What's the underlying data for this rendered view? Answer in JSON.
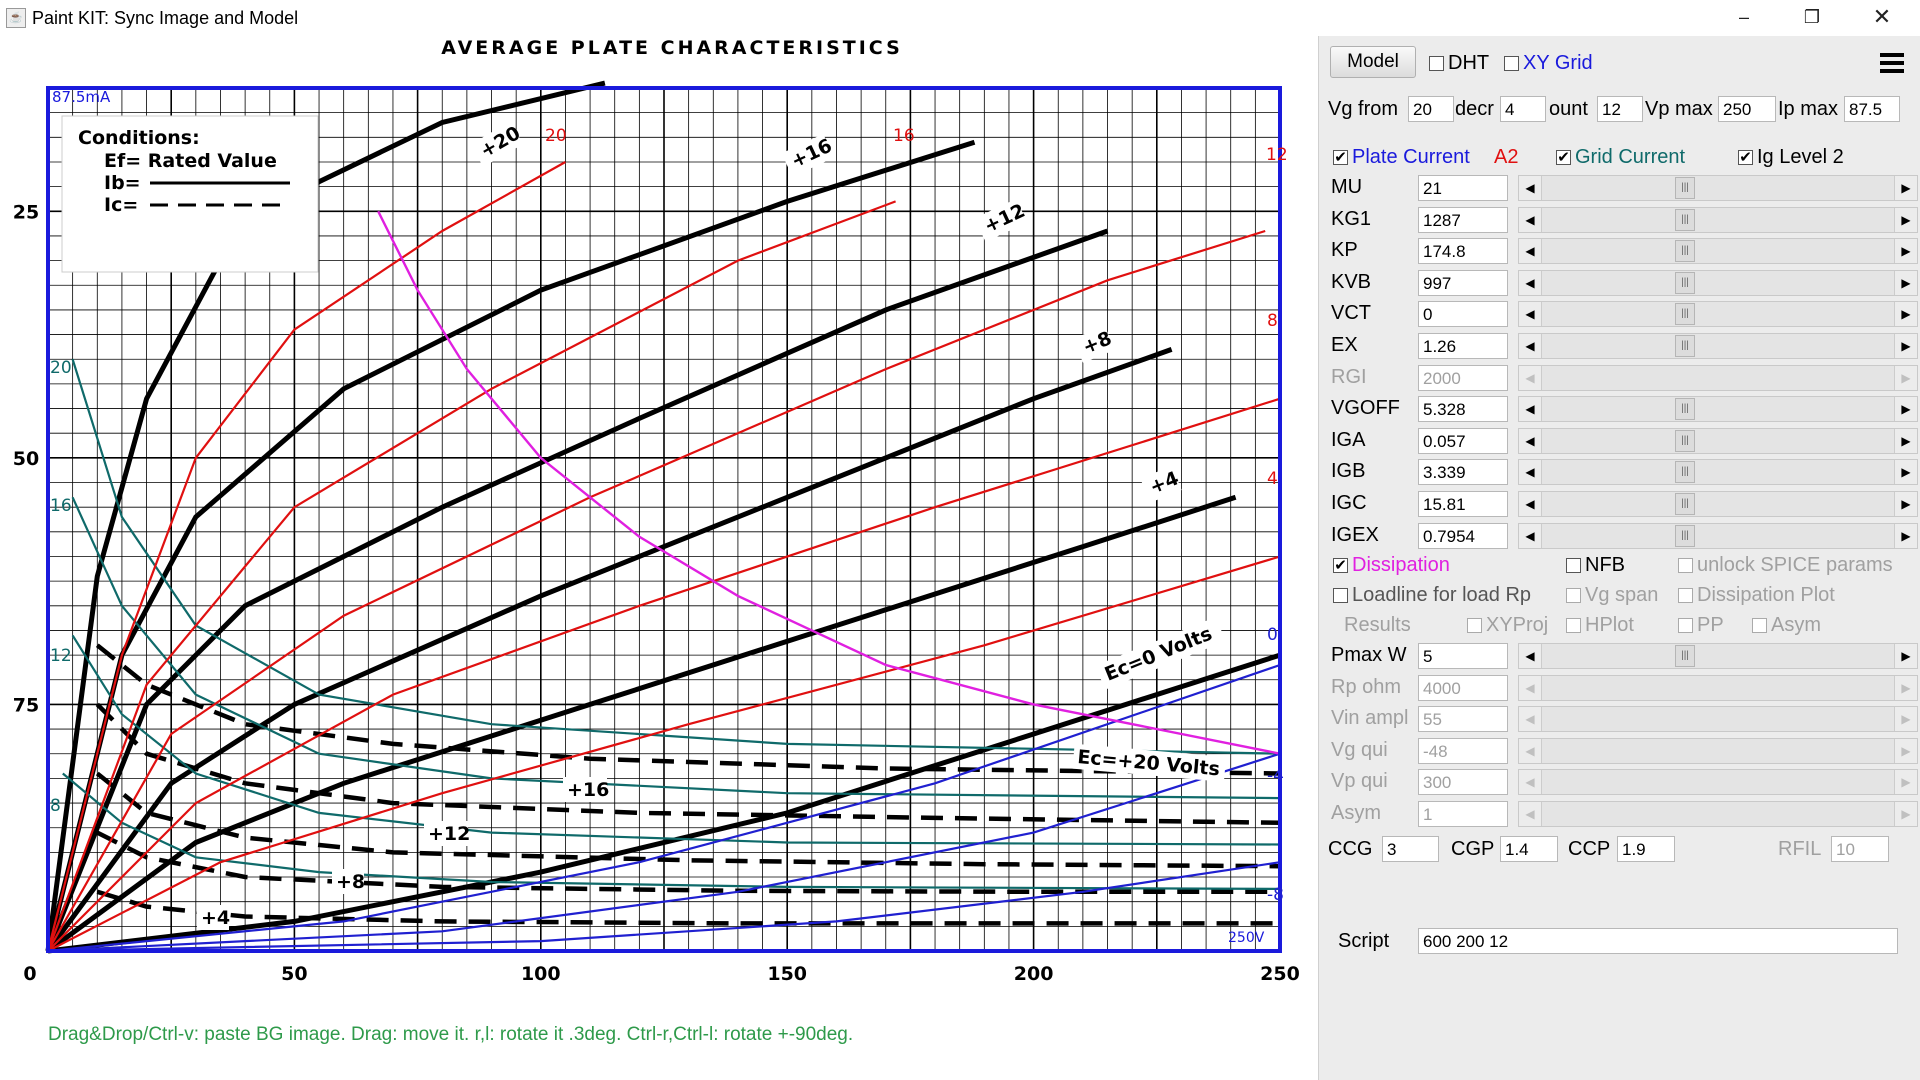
{
  "window": {
    "title": "Paint KIT: Sync Image and Model",
    "icon": "java-icon",
    "controls": [
      "minimize-icon",
      "restore-icon",
      "close-icon"
    ]
  },
  "plot": {
    "chart_title": "AVERAGE PLATE CHARACTERISTICS",
    "x_ticks": [
      "0",
      "50",
      "100",
      "150",
      "200",
      "250"
    ],
    "y_ticks": [
      "75",
      "50",
      "25"
    ],
    "corner_label": "87.5mA",
    "corner_label_br": "250V",
    "conditions": [
      "Conditions:",
      "Ef= Rated Value",
      "Ib=",
      "Ic="
    ],
    "plate_curve_labels": [
      "+20",
      "+16",
      "+12",
      "+8",
      "+4",
      "Ec=0 Volts"
    ],
    "grid_curve_labels": [
      "Ec=+20 Volts",
      "+16",
      "+12",
      "+8",
      "+4"
    ],
    "model_labels_top": [
      "20",
      "16",
      "12"
    ],
    "model_labels_right": [
      "8",
      "4",
      "0",
      "-4",
      "-8"
    ],
    "grid_model_labels_left": [
      "20",
      "16",
      "12",
      "8"
    ],
    "hint": "Drag&Drop/Ctrl-v: paste BG image. Drag: move it. r,l: rotate it .3deg. Ctrl-r,Ctrl-l: rotate +-90deg."
  },
  "chart_data": {
    "type": "line",
    "title": "AVERAGE PLATE CHARACTERISTICS",
    "xlim": [
      0,
      250
    ],
    "ylim": [
      0,
      87.5
    ],
    "x_ticks": [
      0,
      50,
      100,
      150,
      200,
      250
    ],
    "y_ticks": [
      25,
      50,
      75
    ],
    "grid": true,
    "plate_current_series": [
      {
        "name": "+20",
        "points": [
          [
            0,
            0
          ],
          [
            10,
            38
          ],
          [
            20,
            56
          ],
          [
            35,
            70
          ],
          [
            55,
            78
          ],
          [
            80,
            84
          ],
          [
            113,
            88
          ]
        ]
      },
      {
        "name": "+16",
        "points": [
          [
            0,
            0
          ],
          [
            15,
            30
          ],
          [
            30,
            44
          ],
          [
            60,
            57
          ],
          [
            100,
            67
          ],
          [
            150,
            76
          ],
          [
            188,
            82
          ]
        ]
      },
      {
        "name": "+12",
        "points": [
          [
            0,
            0
          ],
          [
            20,
            25
          ],
          [
            40,
            35
          ],
          [
            80,
            45
          ],
          [
            120,
            54
          ],
          [
            170,
            65
          ],
          [
            215,
            73
          ]
        ]
      },
      {
        "name": "+8",
        "points": [
          [
            0,
            0
          ],
          [
            25,
            17
          ],
          [
            50,
            25
          ],
          [
            100,
            36
          ],
          [
            150,
            46
          ],
          [
            200,
            56
          ],
          [
            228,
            61
          ]
        ]
      },
      {
        "name": "+4",
        "points": [
          [
            0,
            0
          ],
          [
            30,
            11
          ],
          [
            60,
            17
          ],
          [
            110,
            25
          ],
          [
            160,
            33
          ],
          [
            210,
            41
          ],
          [
            241,
            46
          ]
        ]
      },
      {
        "name": "Ec=0 Volts",
        "points": [
          [
            0,
            0
          ],
          [
            50,
            3
          ],
          [
            100,
            8
          ],
          [
            150,
            14
          ],
          [
            200,
            22
          ],
          [
            250,
            30
          ]
        ]
      }
    ],
    "grid_current_series": [
      {
        "name": "Ec=+20 Volts",
        "points": [
          [
            10,
            31
          ],
          [
            20,
            27
          ],
          [
            40,
            23
          ],
          [
            70,
            21
          ],
          [
            110,
            19.5
          ],
          [
            170,
            18.5
          ],
          [
            250,
            18
          ]
        ]
      },
      {
        "name": "+16",
        "points": [
          [
            10,
            25
          ],
          [
            20,
            20
          ],
          [
            40,
            17
          ],
          [
            70,
            15
          ],
          [
            120,
            14
          ],
          [
            180,
            13.5
          ],
          [
            250,
            13
          ]
        ]
      },
      {
        "name": "+12",
        "points": [
          [
            10,
            18
          ],
          [
            20,
            14
          ],
          [
            40,
            11.5
          ],
          [
            70,
            10
          ],
          [
            130,
            9.2
          ],
          [
            190,
            8.8
          ],
          [
            250,
            8.6
          ]
        ]
      },
      {
        "name": "+8",
        "points": [
          [
            10,
            12
          ],
          [
            20,
            9.5
          ],
          [
            40,
            7.5
          ],
          [
            80,
            6.5
          ],
          [
            140,
            6.1
          ],
          [
            200,
            6
          ],
          [
            250,
            6
          ]
        ]
      },
      {
        "name": "+4",
        "points": [
          [
            10,
            6
          ],
          [
            20,
            4.5
          ],
          [
            40,
            3.5
          ],
          [
            80,
            3
          ],
          [
            140,
            2.8
          ],
          [
            200,
            2.8
          ],
          [
            250,
            2.8
          ]
        ]
      }
    ],
    "model_plate_series": [
      {
        "name": "20",
        "points": [
          [
            0,
            0
          ],
          [
            15,
            30
          ],
          [
            30,
            50
          ],
          [
            50,
            63
          ],
          [
            80,
            73
          ],
          [
            105,
            80
          ]
        ]
      },
      {
        "name": "16",
        "points": [
          [
            0,
            0
          ],
          [
            20,
            27
          ],
          [
            50,
            45
          ],
          [
            90,
            57
          ],
          [
            140,
            70
          ],
          [
            172,
            76
          ]
        ]
      },
      {
        "name": "12",
        "points": [
          [
            0,
            0
          ],
          [
            25,
            22
          ],
          [
            60,
            34
          ],
          [
            110,
            46
          ],
          [
            170,
            59
          ],
          [
            215,
            68
          ],
          [
            247,
            73
          ]
        ]
      },
      {
        "name": "8",
        "points": [
          [
            0,
            0
          ],
          [
            30,
            15
          ],
          [
            70,
            26
          ],
          [
            120,
            35
          ],
          [
            180,
            45
          ],
          [
            250,
            56
          ]
        ]
      },
      {
        "name": "4",
        "points": [
          [
            0,
            0
          ],
          [
            35,
            9
          ],
          [
            80,
            16
          ],
          [
            130,
            23
          ],
          [
            190,
            31
          ],
          [
            250,
            40
          ]
        ]
      },
      {
        "name": "0",
        "points": [
          [
            0,
            0
          ],
          [
            60,
            3
          ],
          [
            120,
            9
          ],
          [
            180,
            17
          ],
          [
            250,
            29
          ]
        ]
      },
      {
        "name": "-4",
        "points": [
          [
            0,
            0
          ],
          [
            80,
            2
          ],
          [
            140,
            6
          ],
          [
            200,
            12
          ],
          [
            250,
            20
          ]
        ]
      },
      {
        "name": "-8",
        "points": [
          [
            0,
            0
          ],
          [
            100,
            1
          ],
          [
            160,
            3
          ],
          [
            210,
            6
          ],
          [
            250,
            9
          ]
        ]
      }
    ],
    "model_grid_series": [
      {
        "name": "20",
        "points": [
          [
            5,
            60
          ],
          [
            15,
            44
          ],
          [
            30,
            33
          ],
          [
            55,
            26
          ],
          [
            90,
            23
          ],
          [
            150,
            21
          ],
          [
            250,
            20
          ]
        ]
      },
      {
        "name": "16",
        "points": [
          [
            5,
            46
          ],
          [
            15,
            35
          ],
          [
            30,
            26
          ],
          [
            55,
            20
          ],
          [
            90,
            17.5
          ],
          [
            150,
            16
          ],
          [
            250,
            15.5
          ]
        ]
      },
      {
        "name": "12",
        "points": [
          [
            5,
            32
          ],
          [
            15,
            24
          ],
          [
            30,
            18
          ],
          [
            55,
            14
          ],
          [
            90,
            12
          ],
          [
            150,
            11
          ],
          [
            250,
            10.8
          ]
        ]
      },
      {
        "name": "8",
        "points": [
          [
            3,
            18
          ],
          [
            15,
            13
          ],
          [
            30,
            9.5
          ],
          [
            55,
            8
          ],
          [
            90,
            7
          ],
          [
            150,
            6.5
          ],
          [
            250,
            6.3
          ]
        ]
      }
    ],
    "dissipation_curve": [
      [
        67,
        75
      ],
      [
        75,
        67
      ],
      [
        85,
        59
      ],
      [
        100,
        50
      ],
      [
        120,
        42
      ],
      [
        140,
        36
      ],
      [
        170,
        29
      ],
      [
        200,
        25
      ],
      [
        250,
        20
      ]
    ]
  },
  "panel": {
    "model_button": "Model",
    "menu_icon": "hamburger-menu-icon",
    "dht": {
      "label": "DHT",
      "checked": false
    },
    "xy_grid": {
      "label": "XY Grid",
      "checked": false
    },
    "range": {
      "vg_from_label": "Vg from",
      "vg_from": "20",
      "decr_label": "decr",
      "decr": "4",
      "count_label": "ount",
      "count": "12",
      "vp_max_label": "Vp max",
      "vp_max": "250",
      "ip_max_label": "Ip max",
      "ip_max": "87.5"
    },
    "plate_current": {
      "label": "Plate Current",
      "checked": true
    },
    "a2_label": "A2",
    "grid_current": {
      "label": "Grid Current",
      "checked": true
    },
    "ig_level2": {
      "label": "Ig Level 2",
      "checked": true
    },
    "params": [
      {
        "name": "MU",
        "value": "21",
        "enabled": true
      },
      {
        "name": "KG1",
        "value": "1287",
        "enabled": true
      },
      {
        "name": "KP",
        "value": "174.8",
        "enabled": true
      },
      {
        "name": "KVB",
        "value": "997",
        "enabled": true
      },
      {
        "name": "VCT",
        "value": "0",
        "enabled": true
      },
      {
        "name": "EX",
        "value": "1.26",
        "enabled": true
      },
      {
        "name": "RGI",
        "value": "2000",
        "enabled": false
      },
      {
        "name": "VGOFF",
        "value": "5.328",
        "enabled": true
      },
      {
        "name": "IGA",
        "value": "0.057",
        "enabled": true
      },
      {
        "name": "IGB",
        "value": "3.339",
        "enabled": true
      },
      {
        "name": "IGC",
        "value": "15.81",
        "enabled": true
      },
      {
        "name": "IGEX",
        "value": "0.7954",
        "enabled": true
      }
    ],
    "dissipation": {
      "label": "Dissipation",
      "checked": true
    },
    "nfb": {
      "label": "NFB",
      "checked": false
    },
    "unlock_spice": {
      "label": "unlock SPICE params",
      "checked": false
    },
    "loadline": {
      "label": "Loadline for load Rp",
      "checked": false
    },
    "vg_span": {
      "label": "Vg span",
      "checked": false
    },
    "dissipation_plot": {
      "label": "Dissipation Plot",
      "checked": false
    },
    "results_label": "Results",
    "xyproj": {
      "label": "XYProj",
      "checked": false
    },
    "hplot": {
      "label": "HPlot",
      "checked": false
    },
    "pp": {
      "label": "PP",
      "checked": false
    },
    "asym_chk": {
      "label": "Asym",
      "checked": false
    },
    "params2": [
      {
        "name": "Pmax W",
        "value": "5",
        "enabled": true
      },
      {
        "name": "Rp ohm",
        "value": "4000",
        "enabled": false
      },
      {
        "name": "Vin ampl",
        "value": "55",
        "enabled": false
      },
      {
        "name": "Vg qui",
        "value": "-48",
        "enabled": false
      },
      {
        "name": "Vp qui",
        "value": "300",
        "enabled": false
      },
      {
        "name": "Asym",
        "value": "1",
        "enabled": false
      }
    ],
    "caps": {
      "ccg_label": "CCG",
      "ccg": "3",
      "cgp_label": "CGP",
      "cgp": "1.4",
      "ccp_label": "CCP",
      "ccp": "1.9",
      "rfil_label": "RFIL",
      "rfil": "10"
    },
    "script_label": "Script",
    "script_value": "600 200 12"
  },
  "colors": {
    "plot_border": "#1a1adc",
    "model_plate": "#e01010",
    "model_grid": "#0f6a6a",
    "low_vg": "#2020d0",
    "dissipation": "#e020e0",
    "hint": "#2e9a4a",
    "panel_bg": "#ececec"
  }
}
